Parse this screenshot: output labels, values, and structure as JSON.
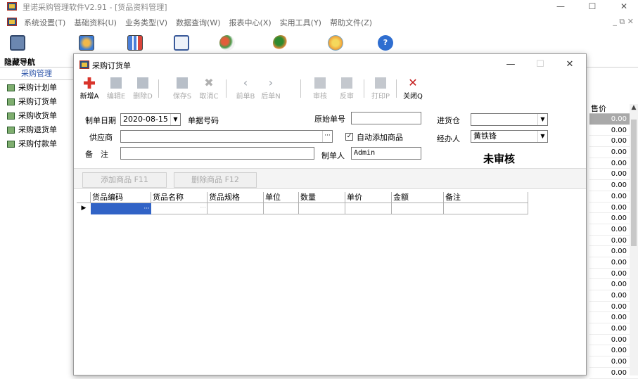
{
  "window": {
    "title": "里诺采购管理软件V2.91 - [货品资料管理]",
    "min_glyph": "—",
    "max_glyph": "☐",
    "close_glyph": "✕"
  },
  "menu": {
    "items": [
      "系统设置(T)",
      "基础资料(U)",
      "业务类型(V)",
      "数据查询(W)",
      "报表中心(X)",
      "实用工具(Y)",
      "帮助文件(Z)"
    ],
    "mdi_controls": "_ ⧉ ✕"
  },
  "main_toolbar": {
    "hide_nav_label": "隐藏导航"
  },
  "left_nav": {
    "header": "采购管理",
    "items": [
      "采购计划单",
      "采购订货单",
      "采购收货单",
      "采购退货单",
      "采购付款单"
    ]
  },
  "background_grid": {
    "header": "售价",
    "values": [
      "0.00",
      "0.00",
      "0.00",
      "0.00",
      "0.00",
      "0.00",
      "0.00",
      "0.00",
      "0.00",
      "0.00",
      "0.00",
      "0.00",
      "0.00",
      "0.00",
      "0.00",
      "0.00",
      "0.00",
      "0.00",
      "0.00",
      "0.00",
      "0.00",
      "0.00",
      "0.00",
      "0.00"
    ]
  },
  "child_window": {
    "title": "采购订货单",
    "min_glyph": "—",
    "max_glyph": "☐",
    "close_glyph": "✕"
  },
  "toolbar": {
    "new_label": "新增A",
    "edit_label": "编辑E",
    "delete_label": "删除D",
    "save_label": "保存S",
    "cancel_label": "取消C",
    "prev_label": "前单B",
    "next_label": "后单N",
    "audit_label": "审核",
    "unaudit_label": "反审",
    "print_label": "打印P",
    "close_label": "关闭Q"
  },
  "form": {
    "date_label": "制单日期",
    "date_value": "2020-08-15",
    "order_no_label": "单据号码",
    "orig_no_label": "原始单号",
    "orig_no_value": "",
    "warehouse_label": "进货仓",
    "warehouse_value": "",
    "supplier_label": "供应商",
    "supplier_value": "",
    "auto_add_label": "自动添加商品",
    "auto_add_checked": "✓",
    "handler_label": "经办人",
    "handler_value": "黄铁锋",
    "remark_label": "备　注",
    "remark_value": "",
    "maker_label": "制单人",
    "maker_value": "Admin",
    "status": "未审核"
  },
  "buttons": {
    "add_goods": "添加商品 F11",
    "delete_goods": "删除商品 F12"
  },
  "table": {
    "headers": [
      "货品编码",
      "货品名称",
      "货品规格",
      "单位",
      "数量",
      "单价",
      "金额",
      "备注"
    ],
    "row_pointer": "▶",
    "ellipsis": "···"
  },
  "colors": {
    "nav_header": "#2b53a8",
    "new_icon": "#d9342b",
    "close_icon": "#c41a1a",
    "disabled_text": "#aaaaaa",
    "selection": "#3163c6"
  },
  "icons": {
    "hide-nav": "monitor-icon",
    "toolbar-1": "globe-icon",
    "toolbar-2": "chart-icon",
    "toolbar-3": "document-search-icon",
    "toolbar-4": "people-icon",
    "toolbar-5": "users-icon",
    "toolbar-6": "palette-icon",
    "toolbar-7": "help-icon",
    "nav-item": "table-icon"
  }
}
